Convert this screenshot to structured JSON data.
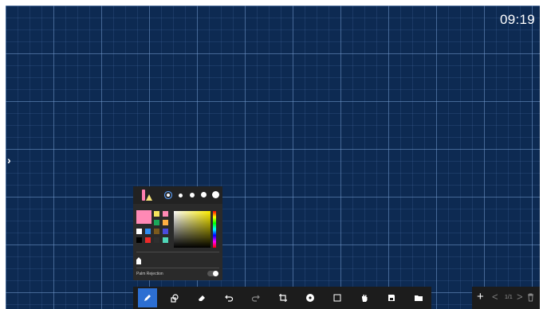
{
  "clock": "09:19",
  "sidebar_toggle_icon": "chevron-right-icon",
  "pen_panel": {
    "pen_types": [
      "pen-icon",
      "highlighter-icon"
    ],
    "stroke_sizes": [
      "size-1",
      "size-2",
      "size-3",
      "size-4",
      "size-5"
    ],
    "selected_color": "#ff89b5",
    "palette": [
      "#f6e45c",
      "#ff89b5",
      "#1ba85a",
      "#ffae43",
      "#ffffff",
      "#2e8cf0",
      "#7a5a1e",
      "#4a4adc",
      "#000000",
      "#ee2a2a",
      "#2f2f2f",
      "#4fd6b8"
    ],
    "palm_rejection_label": "Palm Rejection",
    "palm_rejection_on": false
  },
  "toolbar": {
    "tools": [
      {
        "name": "pen-tool",
        "icon": "pen-icon",
        "active": true
      },
      {
        "name": "shape-tool",
        "icon": "shapes-icon",
        "active": false
      },
      {
        "name": "eraser-tool",
        "icon": "eraser-icon",
        "active": false
      },
      {
        "name": "undo-button",
        "icon": "undo-icon",
        "active": false
      },
      {
        "name": "redo-button",
        "icon": "redo-icon",
        "active": false
      },
      {
        "name": "crop-tool",
        "icon": "crop-icon",
        "active": false
      },
      {
        "name": "background-button",
        "icon": "background-icon",
        "active": false
      },
      {
        "name": "select-tool",
        "icon": "select-icon",
        "active": false
      },
      {
        "name": "pan-tool",
        "icon": "hand-icon",
        "active": false
      },
      {
        "name": "save-button",
        "icon": "save-icon",
        "active": false
      },
      {
        "name": "open-button",
        "icon": "folder-icon",
        "active": false
      }
    ]
  },
  "page_nav": {
    "add_label": "+",
    "prev_label": "<",
    "page_label": "1/1",
    "next_label": ">",
    "delete_icon": "trash-icon"
  }
}
